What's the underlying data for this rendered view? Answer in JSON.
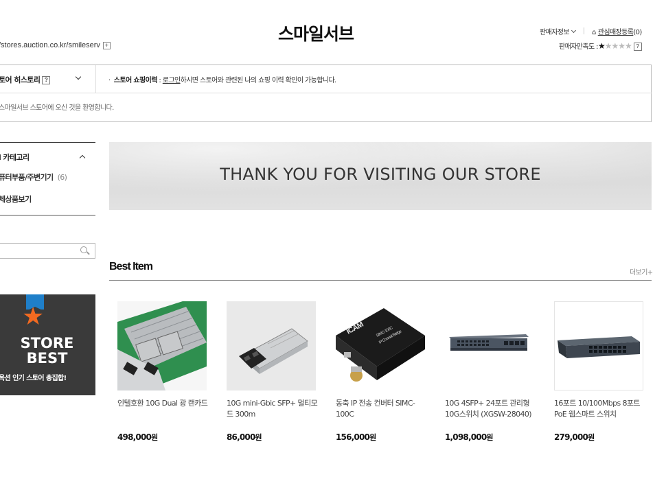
{
  "header": {
    "store_title": "스마일서브",
    "store_url": "/stores.auction.co.kr/smileserv",
    "url_plus": "+",
    "seller_info": "판매자정보",
    "favorite_label": "관심매장등록",
    "favorite_count": "(0)",
    "satisfaction_label": "판매자만족도 :",
    "satisfaction_stars": 1,
    "satisfaction_max": 5,
    "help": "?"
  },
  "history": {
    "label": "토어 히스토리",
    "help": "?",
    "shopping_label": "스토어 쇼핑이력",
    "login_link": "로그인",
    "shopping_text": "하시면 스토어와 관련된 나의 쇼핑 이력 확인이 가능합니다.",
    "welcome": "스마일서브 스토어에 오신 것을 환영합니다."
  },
  "sidebar": {
    "category_title": "l 카테고리",
    "category_item": "퓨터부품/주변기기",
    "category_count": "(6)",
    "all_products": "체상품보기",
    "search_placeholder": "",
    "banner_line1": "STORE",
    "banner_line2": "BEST",
    "banner_sub": "옥션 인기 스토어 총집합!"
  },
  "main": {
    "visit_banner": "THANK YOU FOR VISITING OUR STORE",
    "best_title": "Best Item",
    "more_label": "더보기+",
    "products": [
      {
        "name": "인텔호환 10G Dual 광 랜카드",
        "price": "498,000",
        "won": "원",
        "image": "dual-sfp-network-card"
      },
      {
        "name": "10G mini-Gbic SFP+ 멀티모드 300m",
        "price": "86,000",
        "won": "원",
        "image": "sfp-transceiver-module"
      },
      {
        "name": "동축 IP 전송 컨버터 SIMC-100C",
        "price": "156,000",
        "won": "원",
        "image": "coaxial-ip-converter",
        "device_brand": "ICAM",
        "device_model": "SIMC-100C",
        "device_caption": "IP Coaxial Bridge"
      },
      {
        "name": "10G 4SFP+ 24포트 관리형 10G스위치 (XGSW-28040)",
        "price": "1,098,000",
        "won": "원",
        "image": "managed-switch-24port"
      },
      {
        "name": "16포트 10/100Mbps 8포트 PoE 웹스마트 스위치",
        "price": "279,000",
        "won": "원",
        "image": "poe-switch-16port"
      }
    ]
  },
  "colors": {
    "banner_dark": "#3a3a3a",
    "ribbon_blue": "#1f7fc9",
    "star_orange": "#f26a21"
  }
}
